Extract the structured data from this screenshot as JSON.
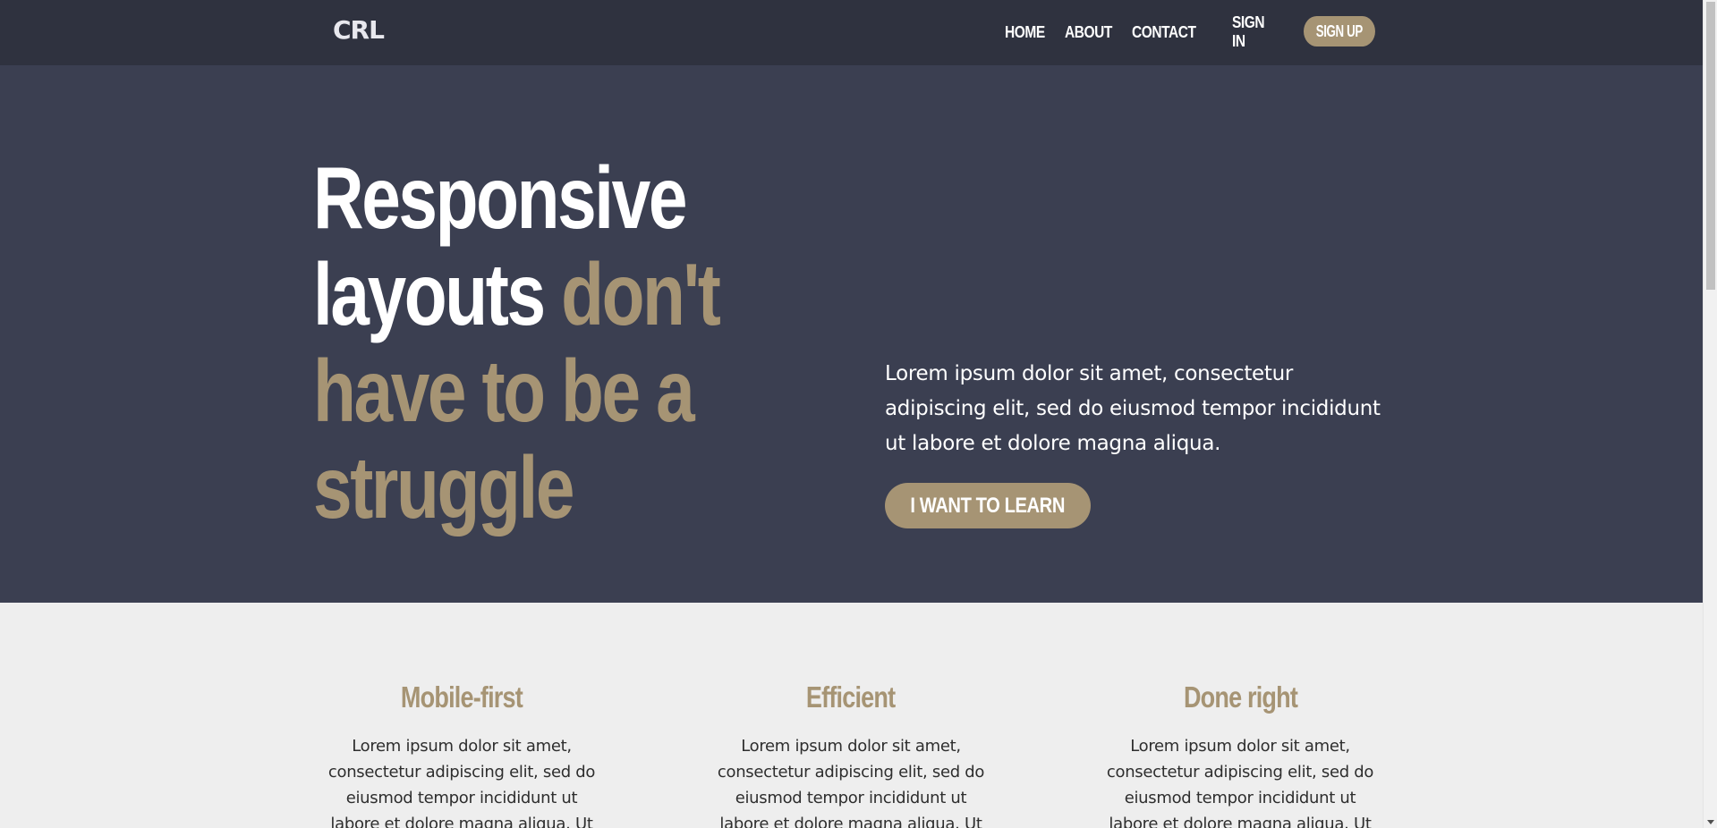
{
  "header": {
    "logo": "CRL",
    "nav": {
      "home": "HOME",
      "about": "ABOUT",
      "contact": "CONTACT",
      "sign_in": "SIGN IN",
      "sign_up": "SIGN UP"
    }
  },
  "hero": {
    "title_part1": "Responsive layouts",
    "title_part2": "don't have to be a struggle",
    "text": "Lorem ipsum dolor sit amet, consectetur adipiscing elit, sed do eiusmod tempor incididunt ut labore et dolore magna aliqua.",
    "cta_label": "I WANT TO LEARN"
  },
  "features": [
    {
      "title": "Mobile-first",
      "text": "Lorem ipsum dolor sit amet, consectetur adipiscing elit, sed do eiusmod tempor incididunt ut labore et dolore magna aliqua. Ut"
    },
    {
      "title": "Efficient",
      "text": "Lorem ipsum dolor sit amet, consectetur adipiscing elit, sed do eiusmod tempor incididunt ut labore et dolore magna aliqua. Ut"
    },
    {
      "title": "Done right",
      "text": "Lorem ipsum dolor sit amet, consectetur adipiscing elit, sed do eiusmod tempor incididunt ut labore et dolore magna aliqua. Ut"
    }
  ],
  "colors": {
    "header_bg": "#2f323f",
    "hero_bg": "#3b3f51",
    "accent": "#a69474",
    "features_bg": "#eeeeee"
  },
  "icons": {
    "scroll_down": "chevron-down-icon"
  }
}
